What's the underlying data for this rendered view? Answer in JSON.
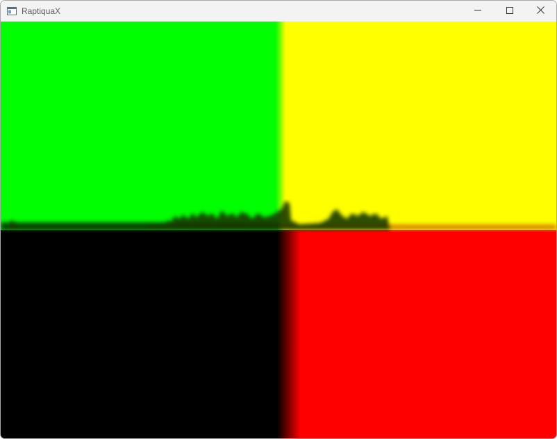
{
  "window": {
    "title": "RaptiquaX",
    "app_icon": "window-app-icon",
    "controls": {
      "minimize_icon": "minimize-icon",
      "maximize_icon": "maximize-icon",
      "close_icon": "close-icon"
    }
  },
  "render": {
    "colors": {
      "top_left": "#00ff00",
      "top_right": "#ffff00",
      "bottom_left": "#000000",
      "bottom_right": "#ff0000"
    }
  }
}
